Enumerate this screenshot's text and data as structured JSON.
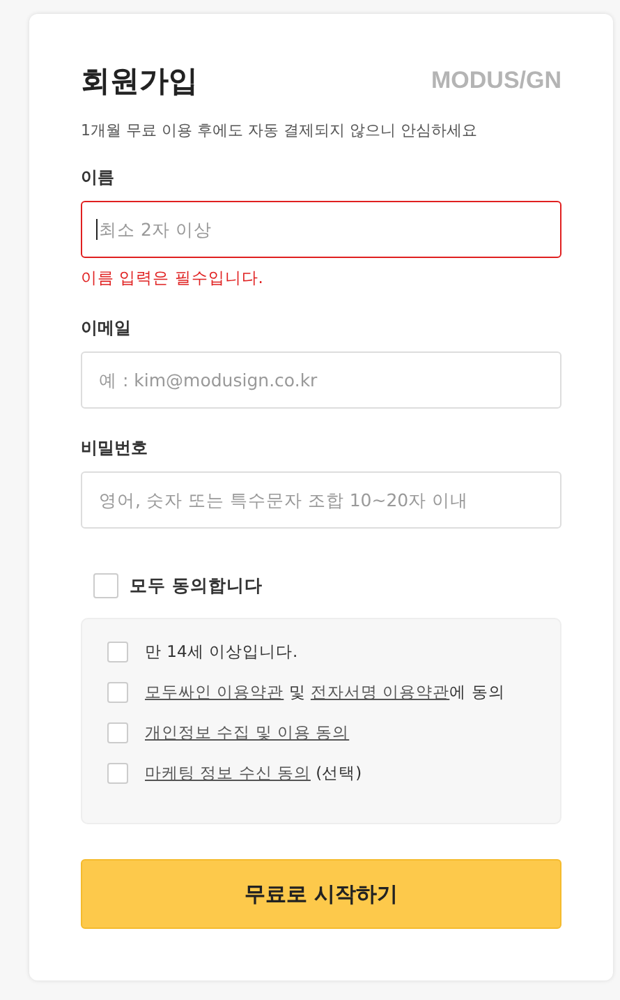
{
  "header": {
    "title": "회원가입",
    "logo": "MODUS/GN",
    "subtitle": "1개월 무료 이용 후에도 자동 결제되지 않으니 안심하세요"
  },
  "fields": [
    {
      "label": "이름",
      "placeholder": "최소 2자 이상",
      "error": true,
      "focused": true,
      "error_message": "이름 입력은 필수입니다."
    },
    {
      "label": "이메일",
      "placeholder": "예 : kim@modusign.co.kr",
      "error": false,
      "focused": false
    },
    {
      "label": "비밀번호",
      "placeholder": "영어, 숫자 또는 특수문자 조합 10~20자 이내",
      "error": false,
      "focused": false
    }
  ],
  "agree_all": {
    "label": "모두 동의합니다",
    "checked": false
  },
  "terms": [
    {
      "checked": false,
      "parts": [
        {
          "text": "만 14세 이상입니다.",
          "link": false
        }
      ]
    },
    {
      "checked": false,
      "parts": [
        {
          "text": "모두싸인 이용약관",
          "link": true
        },
        {
          "text": " 및 ",
          "link": false
        },
        {
          "text": "전자서명 이용약관",
          "link": true
        },
        {
          "text": "에 동의",
          "link": false
        }
      ]
    },
    {
      "checked": false,
      "parts": [
        {
          "text": "개인정보 수집 및 이용 동의",
          "link": true
        }
      ]
    },
    {
      "checked": false,
      "parts": [
        {
          "text": "마케팅 정보 수신 동의",
          "link": true
        },
        {
          "text": " (선택)",
          "link": false
        }
      ]
    }
  ],
  "submit": "무료로 시작하기"
}
